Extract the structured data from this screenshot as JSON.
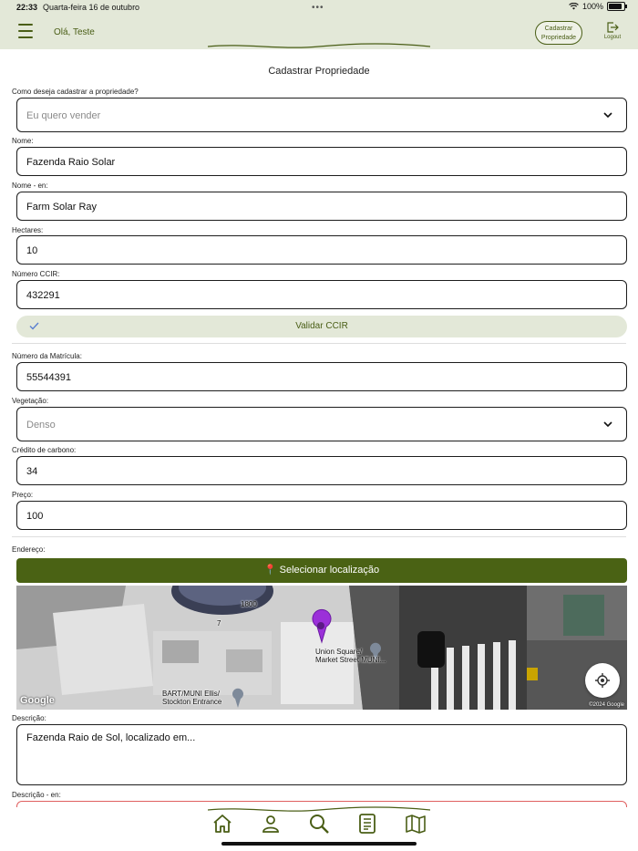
{
  "status": {
    "time": "22:33",
    "date": "Quarta-feira 16 de outubro",
    "battery": "100%"
  },
  "header": {
    "greeting": "Olá, Teste",
    "register_label_1": "Cadastrar",
    "register_label_2": "Propriedade",
    "logout_label": "Logout"
  },
  "form": {
    "title": "Cadastrar Propriedade",
    "mode": {
      "label": "Como deseja cadastrar a propriedade?",
      "placeholder": "Eu quero vender"
    },
    "name": {
      "label": "Nome:",
      "value": "Fazenda Raio Solar"
    },
    "name_en": {
      "label": "Nome - en:",
      "value": "Farm Solar Ray"
    },
    "hectares": {
      "label": "Hectares:",
      "value": "10"
    },
    "ccir": {
      "label": "Número CCIR:",
      "value": "432291"
    },
    "validate_label": "Validar CCIR",
    "matricula": {
      "label": "Número da Matrícula:",
      "value": "55544391"
    },
    "vegetation": {
      "label": "Vegetação:",
      "placeholder": "Denso"
    },
    "carbon": {
      "label": "Crédito de carbono:",
      "value": "34"
    },
    "price": {
      "label": "Preço:",
      "value": "100"
    },
    "address_label": "Endereço:",
    "select_location_label": "Selecionar localização",
    "description": {
      "label": "Descrição:",
      "value": "Fazenda Raio de Sol, localizado em..."
    },
    "description_en": {
      "label": "Descrição - en:",
      "value": ""
    }
  },
  "map": {
    "label_1800": "1800",
    "label_7": "7",
    "poi_1_line1": "Union Square/",
    "poi_1_line2": "Market Street MUNI...",
    "poi_2_line1": "BART/MUNI Ellis/",
    "poi_2_line2": "Stockton Entrance",
    "google": "Google",
    "copyright": "©2024 Google"
  },
  "nav": {
    "items": [
      "home-icon",
      "profile-icon",
      "search-icon",
      "document-icon",
      "map-icon"
    ]
  },
  "colors": {
    "accent": "#4a6214",
    "header_bg": "#e3e8d8",
    "text_green": "#4a5e16"
  }
}
